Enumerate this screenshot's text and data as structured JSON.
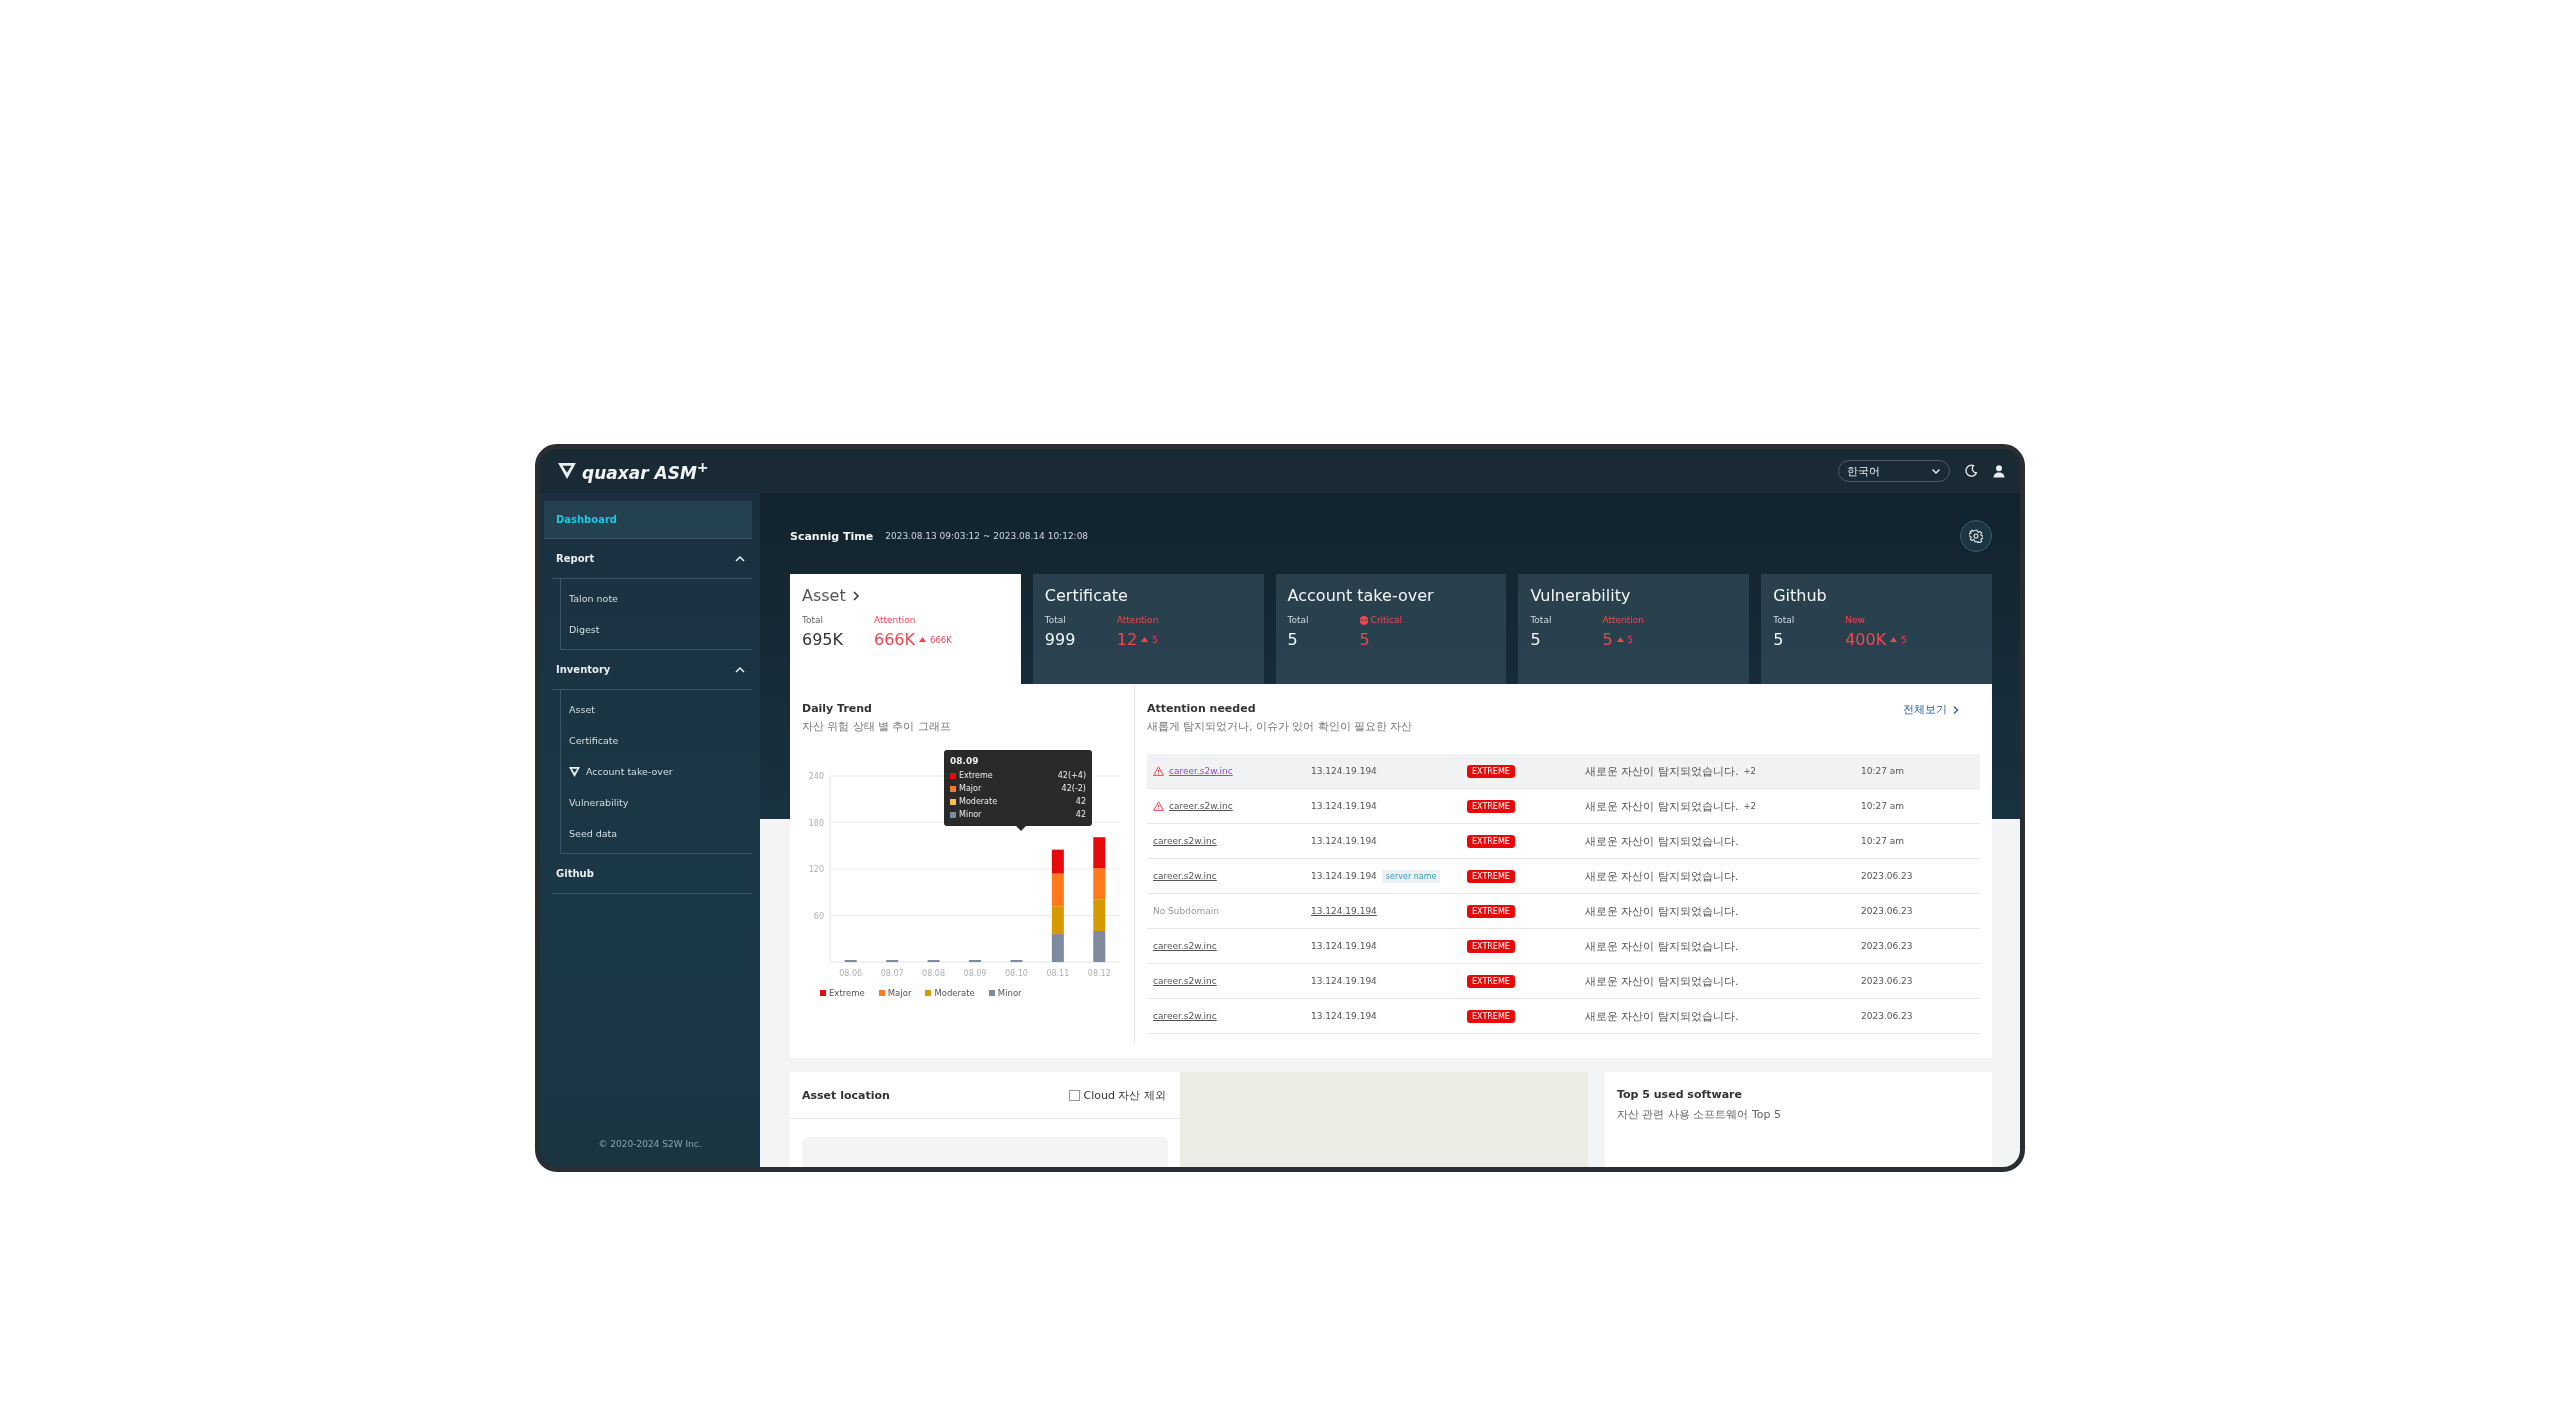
{
  "header": {
    "logo": "quaxar ASM$^{+}$",
    "language": "한국어"
  },
  "sidebar": {
    "items": [
      {
        "label": "Dashboard",
        "kind": "link",
        "selected": true
      },
      {
        "label": "Report",
        "kind": "group",
        "selected": false,
        "expanded": true,
        "children": [
          {
            "label": "Talon note",
            "kind": "link",
            "selected": false
          },
          {
            "label": "Digest",
            "kind": "link",
            "selected": false
          }
        ]
      },
      {
        "label": "Inventory",
        "kind": "group",
        "selected": false,
        "expanded": true,
        "children": [
          {
            "label": "Asset",
            "kind": "link",
            "selected": false
          },
          {
            "label": "Certificate",
            "kind": "link",
            "selected": false
          },
          {
            "label": "Account take-over",
            "kind": "icon-link",
            "selected": false
          },
          {
            "label": "Vulnerability",
            "kind": "link",
            "selected": false
          },
          {
            "label": "Seed data",
            "kind": "link",
            "selected": false
          }
        ]
      },
      {
        "label": "Github",
        "kind": "group-link",
        "selected": false
      }
    ],
    "copyright": "© 2020-2024 S2W Inc."
  },
  "scan": {
    "label": "Scannig Time",
    "value": "2023.08.13 09:03:12 ~ 2023.08.14 10:12:08"
  },
  "cards": [
    {
      "title": "Asset",
      "selected": true,
      "stats": [
        {
          "kind": "total",
          "label": "Total",
          "value": "695K"
        },
        {
          "kind": "alert",
          "label": "Attention",
          "value": "666K",
          "delta": "666K"
        }
      ]
    },
    {
      "title": "Certificate",
      "selected": false,
      "stats": [
        {
          "kind": "total",
          "label": "Total",
          "value": "999"
        },
        {
          "kind": "alert",
          "label": "Attention",
          "value": "12",
          "delta": "5"
        }
      ]
    },
    {
      "title": "Account take-over",
      "selected": false,
      "stats": [
        {
          "kind": "total",
          "label": "Total",
          "value": "5"
        },
        {
          "kind": "critical",
          "label": "Critical",
          "value": "5"
        }
      ]
    },
    {
      "title": "Vulnerability",
      "selected": false,
      "stats": [
        {
          "kind": "total",
          "label": "Total",
          "value": "5"
        },
        {
          "kind": "alert",
          "label": "Attention",
          "value": "5",
          "delta": "5"
        }
      ]
    },
    {
      "title": "Github",
      "selected": false,
      "stats": [
        {
          "kind": "total",
          "label": "Total",
          "value": "5"
        },
        {
          "kind": "alert",
          "label": "New",
          "value": "400K",
          "delta": "5"
        }
      ]
    }
  ],
  "trend": {
    "title": "Daily Trend",
    "subtitle": "자산 위험 상태 별 추이 그래프",
    "chart_data": {
      "type": "bar",
      "stacked": true,
      "grid": true,
      "legend": true,
      "categories": [
        "08.06",
        "08.07",
        "08.08",
        "08.09",
        "08.10",
        "08.11",
        "08.12"
      ],
      "ylim": [
        0,
        240
      ],
      "yticks": [
        60,
        120,
        180,
        240
      ],
      "series": [
        {
          "name": "Extreme",
          "color": "#e60a0a",
          "values": [
            0,
            0,
            0,
            0,
            0,
            31,
            40
          ]
        },
        {
          "name": "Major",
          "color": "#ff7a1a",
          "values": [
            0,
            0,
            0,
            0,
            0,
            42,
            40
          ]
        },
        {
          "name": "Moderate",
          "color": "#d49a00",
          "values": [
            0,
            0,
            0,
            0,
            0,
            36,
            41
          ]
        },
        {
          "name": "Minor",
          "color": "#7d8aa0",
          "values": [
            1,
            1,
            1,
            1,
            1,
            36,
            40
          ]
        }
      ]
    },
    "tooltip": {
      "title": "08.09",
      "items": [
        {
          "label": "Extreme",
          "value": "42(+4)",
          "color": "#e60a0a"
        },
        {
          "label": "Major",
          "value": "42(-2)",
          "color": "#ff7a1a"
        },
        {
          "label": "Moderate",
          "value": "42",
          "color": "#f5c242"
        },
        {
          "label": "Minor",
          "value": "42",
          "color": "#7d8aa0"
        }
      ]
    }
  },
  "attention": {
    "title": "Attention needed",
    "subtitle": "새롭게 탐지되었거나, 이슈가 있어 확인이 필요한 자산",
    "view_all": "전체보기",
    "rows": [
      {
        "selected": true,
        "warning": true,
        "domain": "career.s2w.inc",
        "visited": true,
        "muted": false,
        "ip": "13.124.19.194",
        "ip_link": false,
        "severity": "EXTREME",
        "message": "새로운 자산이 탐지되었습니다.",
        "count": "+2",
        "time": "10:27 am"
      },
      {
        "selected": false,
        "warning": true,
        "domain": "career.s2w.inc",
        "visited": false,
        "muted": false,
        "ip": "13.124.19.194",
        "ip_link": false,
        "severity": "EXTREME",
        "message": "새로운 자산이 탐지되었습니다.",
        "count": "+2",
        "time": "10:27 am"
      },
      {
        "selected": false,
        "warning": false,
        "domain": "career.s2w.inc",
        "visited": false,
        "muted": false,
        "ip": "13.124.19.194",
        "ip_link": false,
        "severity": "EXTREME",
        "message": "새로운 자산이 탐지되었습니다.",
        "time": "10:27 am"
      },
      {
        "selected": false,
        "warning": false,
        "domain": "career.s2w.inc",
        "visited": false,
        "muted": false,
        "ip": "13.124.19.194",
        "ip_link": false,
        "tag": "server name",
        "severity": "EXTREME",
        "message": "새로운 자산이 탐지되었습니다.",
        "time": "2023.06.23"
      },
      {
        "selected": false,
        "warning": false,
        "domain": "No Subdomain",
        "muted": true,
        "ip": "13.124.19.194",
        "ip_link": true,
        "severity": "EXTREME",
        "message": "새로운 자산이 탐지되었습니다.",
        "time": "2023.06.23"
      },
      {
        "selected": false,
        "warning": false,
        "domain": "career.s2w.inc",
        "visited": false,
        "muted": false,
        "ip": "13.124.19.194",
        "ip_link": false,
        "severity": "EXTREME",
        "message": "새로운 자산이 탐지되었습니다.",
        "time": "2023.06.23"
      },
      {
        "selected": false,
        "warning": false,
        "domain": "career.s2w.inc",
        "visited": false,
        "muted": false,
        "ip": "13.124.19.194",
        "ip_link": false,
        "severity": "EXTREME",
        "message": "새로운 자산이 탐지되었습니다.",
        "time": "2023.06.23"
      },
      {
        "selected": false,
        "warning": false,
        "domain": "career.s2w.inc",
        "visited": false,
        "muted": false,
        "ip": "13.124.19.194",
        "ip_link": false,
        "severity": "EXTREME",
        "message": "새로운 자산이 탐지되었습니다.",
        "time": "2023.06.23"
      }
    ]
  },
  "asset_location": {
    "title": "Asset location",
    "cloud_filter": {
      "label": "Cloud 자산 제외",
      "checked": false
    }
  },
  "top_software": {
    "title": "Top 5 used software",
    "subtitle": "자산 관련 사용 소프트웨어 Top 5"
  }
}
